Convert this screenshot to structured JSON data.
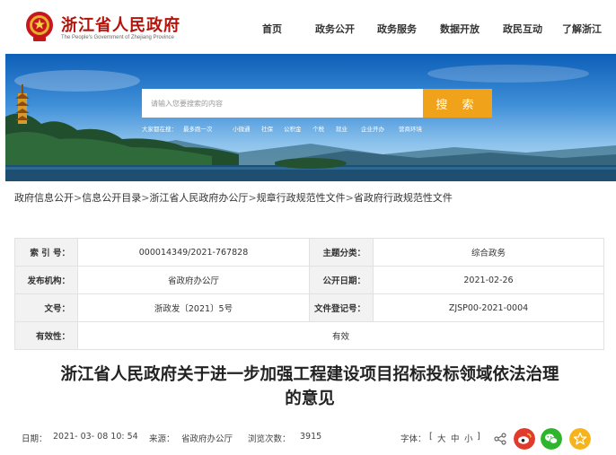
{
  "header": {
    "site_title": "浙江省人民政府",
    "site_subtitle": "The People's Government of Zhejiang Province",
    "nav": [
      "首页",
      "政务公开",
      "政务服务",
      "数据开放",
      "政民互动",
      "了解浙江"
    ]
  },
  "banner": {
    "search_placeholder": "请输入您要搜索的内容",
    "search_button": "搜 索",
    "hot_prefix": "大家都在搜：",
    "hot_keywords": [
      "最多跑一次",
      "小微通",
      "社保",
      "公积金",
      "个税",
      "就业",
      "企业开办",
      "营商环境"
    ]
  },
  "breadcrumb": [
    "政府信息公开",
    "信息公开目录",
    "浙江省人民政府办公厅",
    "规章行政规范性文件",
    "省政府行政规范性文件"
  ],
  "breadcrumb_sep": ">",
  "info": {
    "index_label": "索 引 号：",
    "index_value": "000014349/2021-767828",
    "topic_label": "主题分类：",
    "topic_value": "综合政务",
    "issuer_label": "发布机构：",
    "issuer_value": "省政府办公厅",
    "date_label": "公开日期：",
    "date_value": "2021-02-26",
    "docno_label": "文号：",
    "docno_value": "浙政发〔2021〕5号",
    "regno_label": "文件登记号：",
    "regno_value": "ZJSP00-2021-0004",
    "validity_label": "有效性：",
    "validity_value": "有效"
  },
  "article": {
    "title_line1": "浙江省人民政府关于进一步加强工程建设项目招标投标领域依法治理",
    "title_line2": "的意见"
  },
  "meta": {
    "date_label": "日期：",
    "date_value": "2021- 03- 08 10: 54",
    "source_label": "来源：",
    "source_value": "省政府办公厅",
    "views_label": "浏览次数：",
    "views_value": "3915",
    "font_label": "字体：",
    "font_open": "[",
    "font_large": "大",
    "font_medium": "中",
    "font_small": "小",
    "font_close": "]"
  },
  "colors": {
    "brand_red": "#b2140c",
    "search_orange": "#f0a21a",
    "weibo_red": "#e03b2c",
    "wechat_green": "#2fb52d",
    "favorite_gold": "#f6b31b"
  },
  "icons": [
    "national-emblem-icon",
    "share-link-icon",
    "weibo-icon",
    "wechat-icon",
    "favorite-star-icon"
  ]
}
